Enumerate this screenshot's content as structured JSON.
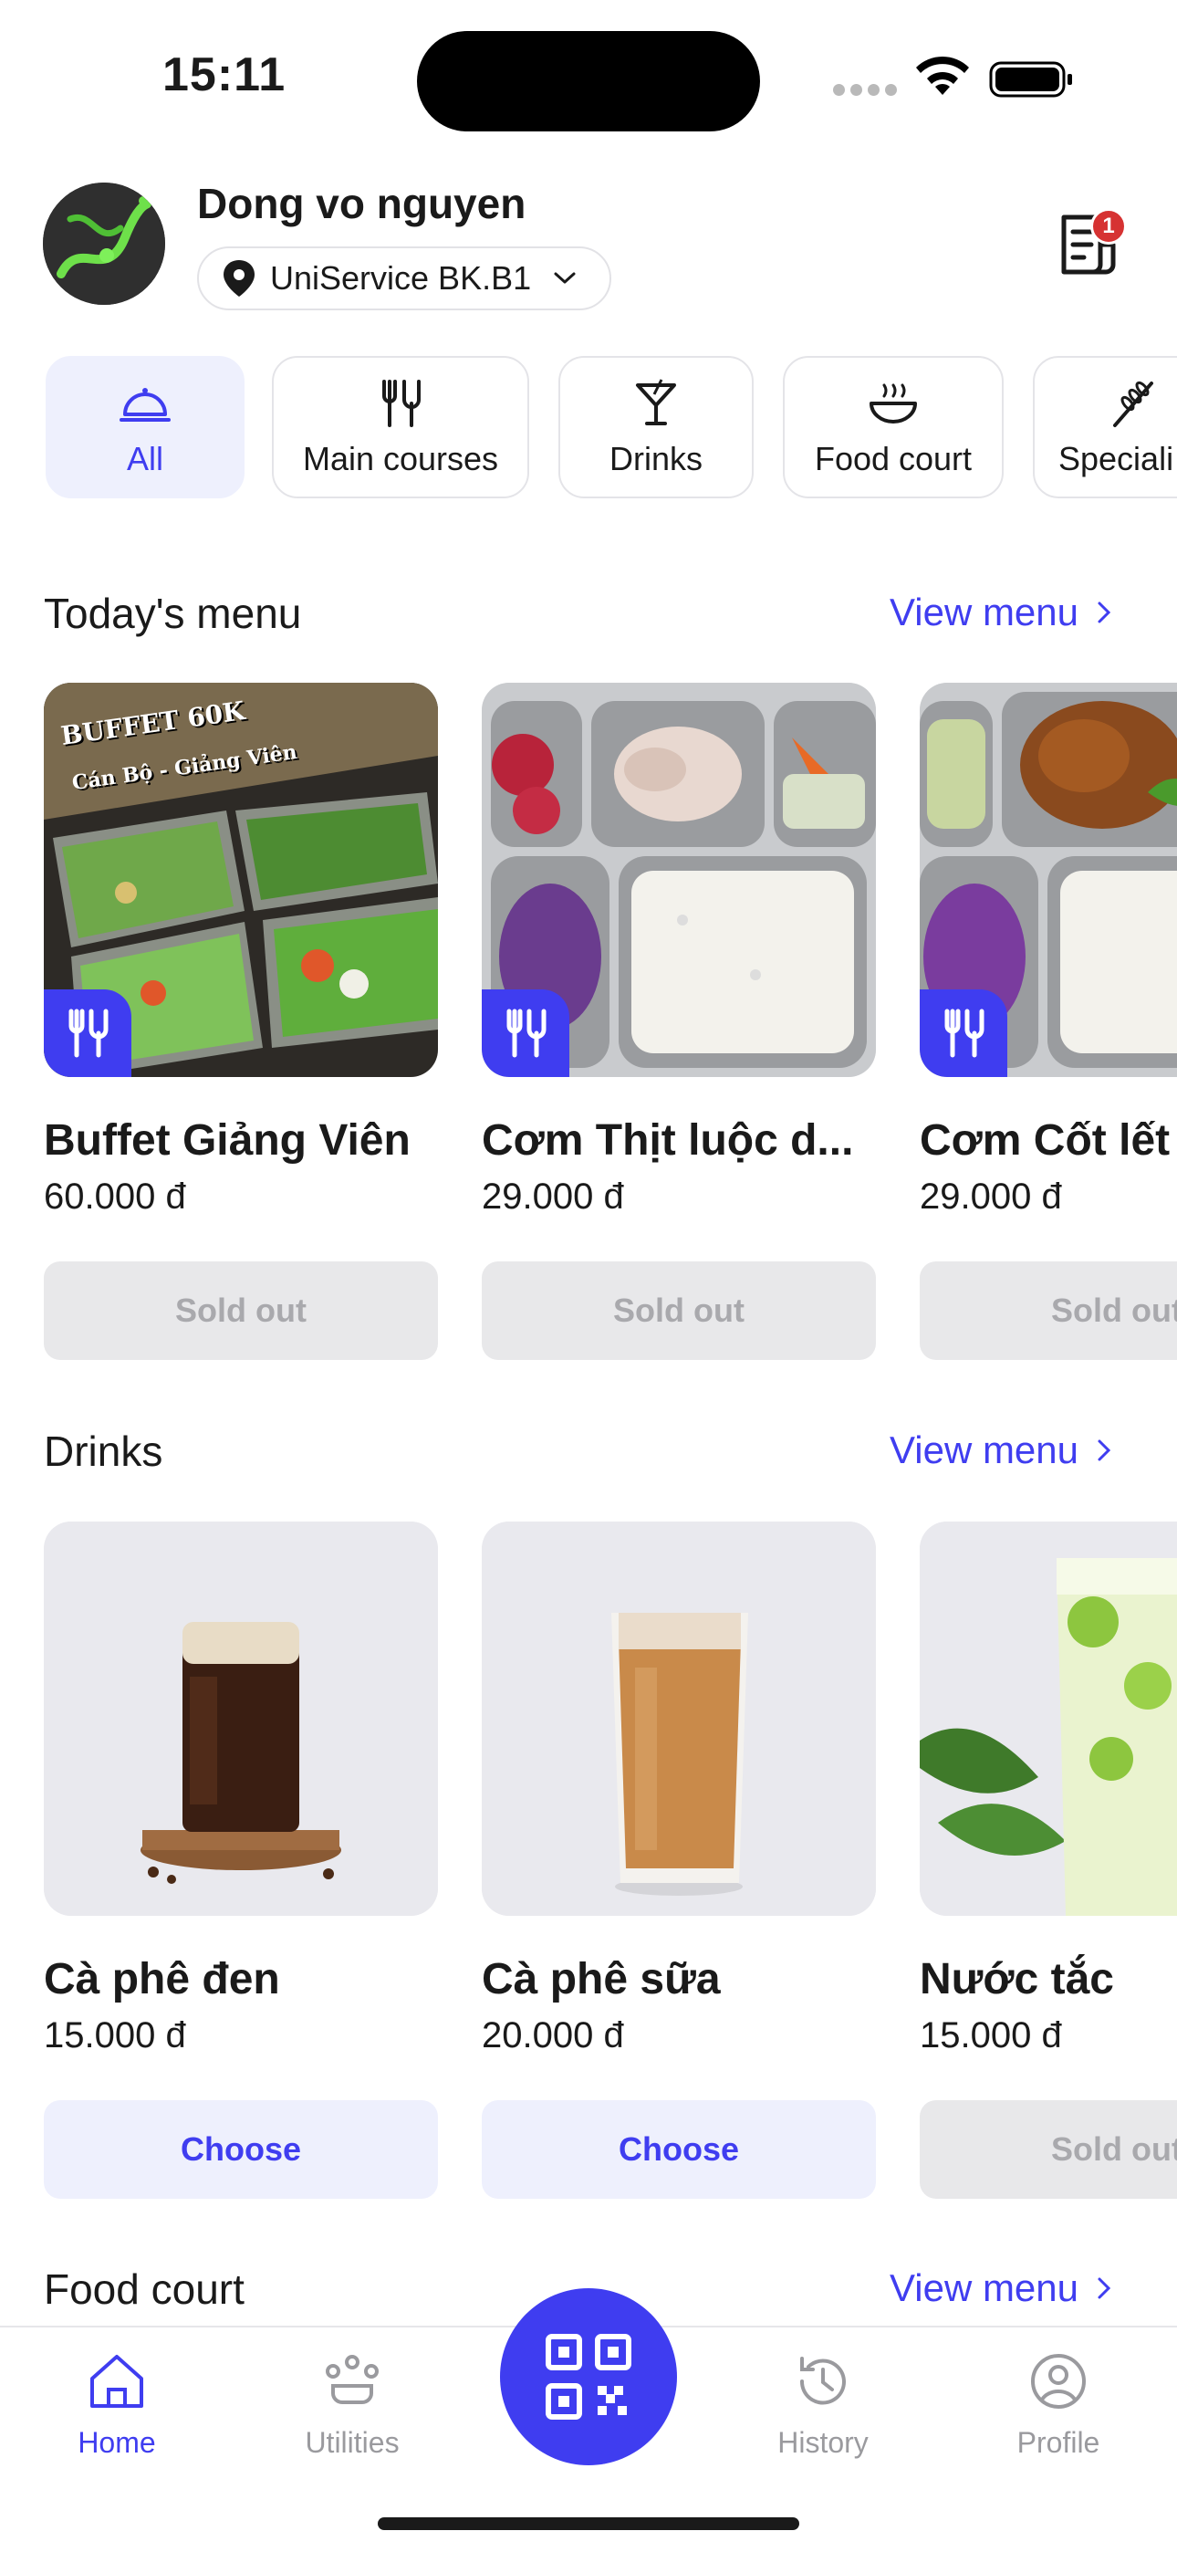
{
  "status_bar": {
    "time": "15:11"
  },
  "header": {
    "user_name": "Dong vo nguyen",
    "location": "UniService BK.B1",
    "notification_count": "1"
  },
  "categories": [
    {
      "label": "All",
      "icon": "cloche-icon",
      "active": true
    },
    {
      "label": "Main courses",
      "icon": "fork-knife-icon",
      "active": false
    },
    {
      "label": "Drinks",
      "icon": "cocktail-icon",
      "active": false
    },
    {
      "label": "Food court",
      "icon": "bowl-icon",
      "active": false
    },
    {
      "label": "Speciali",
      "icon": "wheat-icon",
      "active": false
    }
  ],
  "sections": {
    "todays_menu": {
      "title": "Today's menu",
      "view_menu": "View menu",
      "items": [
        {
          "name": " Buffet Giảng Viên",
          "price": "60.000 đ",
          "button": "Sold out",
          "image_text_1": "BUFFET 60K",
          "image_text_2": "Cán Bộ - Giảng Viên"
        },
        {
          "name": "Cơm Thịt luộc d...",
          "price": "29.000 đ",
          "button": "Sold out"
        },
        {
          "name": "Cơm Cốt lết",
          "price": "29.000 đ",
          "button": "Sold out"
        }
      ]
    },
    "drinks": {
      "title": "Drinks",
      "view_menu": "View menu",
      "items": [
        {
          "name": "Cà phê đen",
          "price": "15.000 đ",
          "button": "Choose"
        },
        {
          "name": "Cà phê sữa",
          "price": "20.000 đ",
          "button": "Choose"
        },
        {
          "name": "Nước tắc",
          "price": "15.000 đ",
          "button": "Sold out"
        }
      ]
    },
    "food_court": {
      "title": "Food court",
      "view_menu": "View menu"
    }
  },
  "bottom_nav": {
    "home": "Home",
    "utilities": "Utilities",
    "history": "History",
    "profile": "Profile"
  },
  "colors": {
    "accent": "#3f3df0",
    "accent_light": "#eef0fd",
    "sold_out_bg": "#e8e8ea",
    "sold_out_text": "#a9a9ad",
    "badge": "#d63232"
  }
}
